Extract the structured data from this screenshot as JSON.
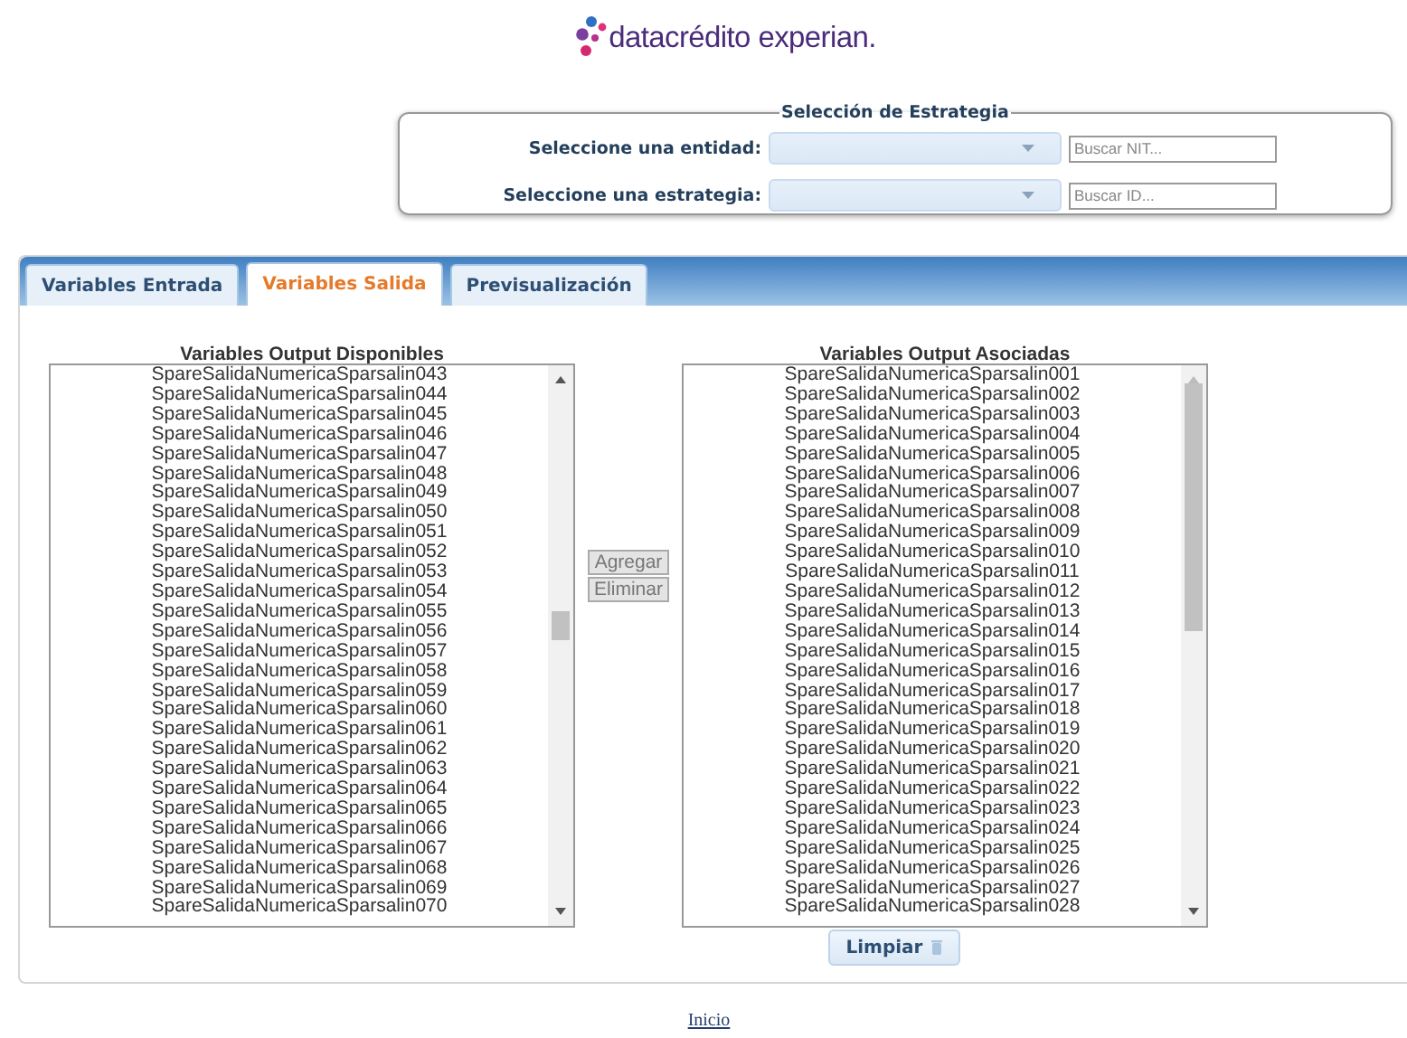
{
  "logo": {
    "text": "datacrédito experian."
  },
  "strategy": {
    "legend": "Selección de Estrategia",
    "rows": [
      {
        "label": "Seleccione una entidad:",
        "search_placeholder": "Buscar NIT..."
      },
      {
        "label": "Seleccione una estrategia:",
        "search_placeholder": "Buscar ID..."
      }
    ]
  },
  "tabs": [
    {
      "label": "Variables Entrada",
      "selected": false
    },
    {
      "label": "Variables Salida",
      "selected": true
    },
    {
      "label": "Previsualización",
      "selected": false
    }
  ],
  "available": {
    "title": "Variables Output Disponibles",
    "items": [
      "SpareSalidaNumericaSparsalin043",
      "SpareSalidaNumericaSparsalin044",
      "SpareSalidaNumericaSparsalin045",
      "SpareSalidaNumericaSparsalin046",
      "SpareSalidaNumericaSparsalin047",
      "SpareSalidaNumericaSparsalin048",
      "SpareSalidaNumericaSparsalin049",
      "SpareSalidaNumericaSparsalin050",
      "SpareSalidaNumericaSparsalin051",
      "SpareSalidaNumericaSparsalin052",
      "SpareSalidaNumericaSparsalin053",
      "SpareSalidaNumericaSparsalin054",
      "SpareSalidaNumericaSparsalin055",
      "SpareSalidaNumericaSparsalin056",
      "SpareSalidaNumericaSparsalin057",
      "SpareSalidaNumericaSparsalin058",
      "SpareSalidaNumericaSparsalin059",
      "SpareSalidaNumericaSparsalin060",
      "SpareSalidaNumericaSparsalin061",
      "SpareSalidaNumericaSparsalin062",
      "SpareSalidaNumericaSparsalin063",
      "SpareSalidaNumericaSparsalin064",
      "SpareSalidaNumericaSparsalin065",
      "SpareSalidaNumericaSparsalin066",
      "SpareSalidaNumericaSparsalin067",
      "SpareSalidaNumericaSparsalin068",
      "SpareSalidaNumericaSparsalin069",
      "SpareSalidaNumericaSparsalin070"
    ]
  },
  "actions": [
    {
      "label": "Agregar",
      "disabled": true
    },
    {
      "label": "Eliminar",
      "disabled": true
    }
  ],
  "associated": {
    "title": "Variables Output Asociadas",
    "items": [
      "SpareSalidaNumericaSparsalin001",
      "SpareSalidaNumericaSparsalin002",
      "SpareSalidaNumericaSparsalin003",
      "SpareSalidaNumericaSparsalin004",
      "SpareSalidaNumericaSparsalin005",
      "SpareSalidaNumericaSparsalin006",
      "SpareSalidaNumericaSparsalin007",
      "SpareSalidaNumericaSparsalin008",
      "SpareSalidaNumericaSparsalin009",
      "SpareSalidaNumericaSparsalin010",
      "SpareSalidaNumericaSparsalin011",
      "SpareSalidaNumericaSparsalin012",
      "SpareSalidaNumericaSparsalin013",
      "SpareSalidaNumericaSparsalin014",
      "SpareSalidaNumericaSparsalin015",
      "SpareSalidaNumericaSparsalin016",
      "SpareSalidaNumericaSparsalin017",
      "SpareSalidaNumericaSparsalin018",
      "SpareSalidaNumericaSparsalin019",
      "SpareSalidaNumericaSparsalin020",
      "SpareSalidaNumericaSparsalin021",
      "SpareSalidaNumericaSparsalin022",
      "SpareSalidaNumericaSparsalin023",
      "SpareSalidaNumericaSparsalin024",
      "SpareSalidaNumericaSparsalin025",
      "SpareSalidaNumericaSparsalin026",
      "SpareSalidaNumericaSparsalin027",
      "SpareSalidaNumericaSparsalin028"
    ]
  },
  "clear_button": {
    "label": "Limpiar"
  },
  "footer_link": "Inicio"
}
